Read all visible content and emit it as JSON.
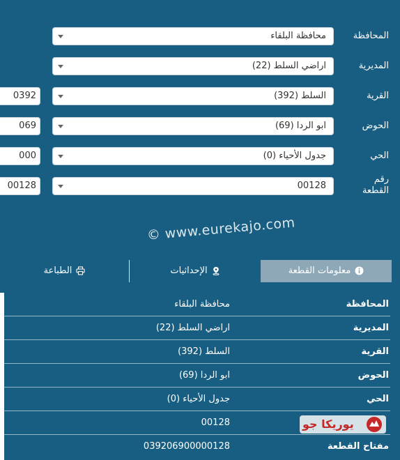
{
  "form": {
    "governorate": {
      "label": "المحافظة",
      "value": "محافظة البلقاء"
    },
    "directorate": {
      "label": "المديرية",
      "value": "اراضي السلط (22)"
    },
    "village": {
      "label": "القرية",
      "value": "السلط (392)",
      "code": "0392"
    },
    "basin": {
      "label": "الحوض",
      "value": "ابو الردا (69)",
      "code": "069"
    },
    "neighborhood": {
      "label": "الحي",
      "value": "جدول الأحياء (0)",
      "code": "000"
    },
    "parcel": {
      "label_line1": "رقم",
      "label_line2": "القطعة",
      "value": "00128",
      "code": "00128"
    }
  },
  "watermark": "© www.eurekajo.com",
  "tabs": [
    {
      "label": "معلومات القطعة",
      "icon": "info-icon",
      "active": true
    },
    {
      "label": "الإحداثيات",
      "icon": "location-pin-icon",
      "active": false
    },
    {
      "label": "الطباعة",
      "icon": "printer-icon",
      "active": false
    }
  ],
  "info": [
    {
      "key": "المحافظة",
      "value": "محافظة البلقاء"
    },
    {
      "key": "المديرية",
      "value": "اراضي السلط (22)"
    },
    {
      "key": "القرية",
      "value": "السلط (392)"
    },
    {
      "key": "الحوض",
      "value": "ابو الردا (69)"
    },
    {
      "key": "الحي",
      "value": "جدول الأحياء (0)"
    },
    {
      "key": "",
      "value": "00128"
    },
    {
      "key": "مفتاح القطعة",
      "value": "039206900000128"
    }
  ],
  "logo": {
    "text": "يوريكا جو",
    "icon": "logo-emblem-icon",
    "color": "#c62828"
  },
  "colors": {
    "background": "#175e82",
    "active_tab": "#8ea8b8"
  }
}
